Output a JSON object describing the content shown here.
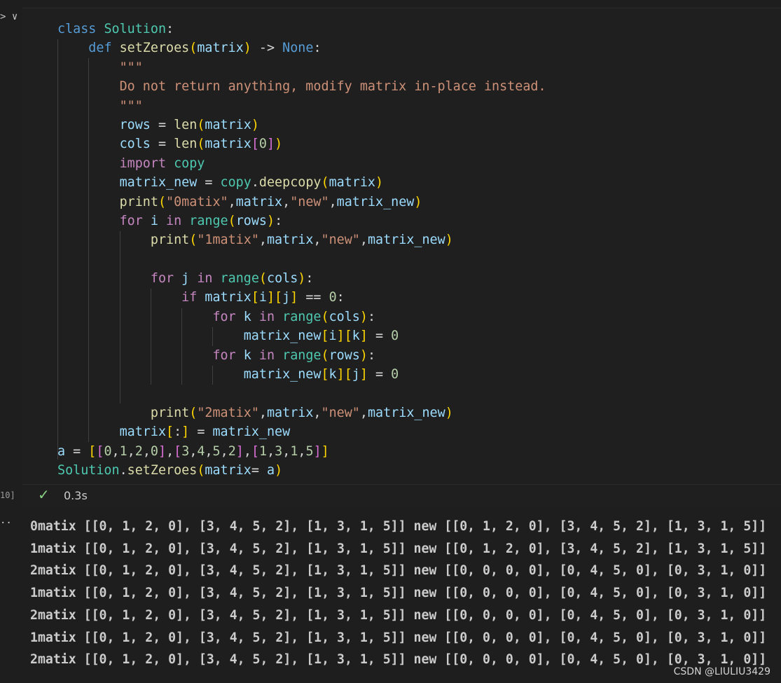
{
  "gutter": {
    "toggle": "> ∨",
    "execution_count": "10]",
    "output_marker": "··"
  },
  "code_lines": [
    [
      {
        "t": "class ",
        "c": "kw"
      },
      {
        "t": "Solution",
        "c": "cls"
      },
      {
        "t": ":",
        "c": "op"
      }
    ],
    [
      {
        "t": "    "
      },
      {
        "t": "def ",
        "c": "kw"
      },
      {
        "t": "setZeroes",
        "c": "fn"
      },
      {
        "t": "(",
        "c": "b1"
      },
      {
        "t": "matrix",
        "c": "var"
      },
      {
        "t": ")",
        "c": "b1"
      },
      {
        "t": " -> ",
        "c": "op"
      },
      {
        "t": "None",
        "c": "kw"
      },
      {
        "t": ":",
        "c": "op"
      }
    ],
    [
      {
        "t": "        "
      },
      {
        "t": "\"\"\"",
        "c": "str"
      }
    ],
    [
      {
        "t": "        "
      },
      {
        "t": "Do not return anything, modify matrix in-place instead.",
        "c": "str"
      }
    ],
    [
      {
        "t": "        "
      },
      {
        "t": "\"\"\"",
        "c": "str"
      }
    ],
    [
      {
        "t": "        "
      },
      {
        "t": "rows",
        "c": "var"
      },
      {
        "t": " = ",
        "c": "op"
      },
      {
        "t": "len",
        "c": "fn"
      },
      {
        "t": "(",
        "c": "b1"
      },
      {
        "t": "matrix",
        "c": "var"
      },
      {
        "t": ")",
        "c": "b1"
      }
    ],
    [
      {
        "t": "        "
      },
      {
        "t": "cols",
        "c": "var"
      },
      {
        "t": " = ",
        "c": "op"
      },
      {
        "t": "len",
        "c": "fn"
      },
      {
        "t": "(",
        "c": "b1"
      },
      {
        "t": "matrix",
        "c": "var"
      },
      {
        "t": "[",
        "c": "b2"
      },
      {
        "t": "0",
        "c": "num"
      },
      {
        "t": "]",
        "c": "b2"
      },
      {
        "t": ")",
        "c": "b1"
      }
    ],
    [
      {
        "t": "        "
      },
      {
        "t": "import ",
        "c": "ctl"
      },
      {
        "t": "copy",
        "c": "cls"
      }
    ],
    [
      {
        "t": "        "
      },
      {
        "t": "matrix_new",
        "c": "var"
      },
      {
        "t": " = ",
        "c": "op"
      },
      {
        "t": "copy",
        "c": "cls"
      },
      {
        "t": ".",
        "c": "op"
      },
      {
        "t": "deepcopy",
        "c": "fn"
      },
      {
        "t": "(",
        "c": "b1"
      },
      {
        "t": "matrix",
        "c": "var"
      },
      {
        "t": ")",
        "c": "b1"
      }
    ],
    [
      {
        "t": "        "
      },
      {
        "t": "print",
        "c": "fn"
      },
      {
        "t": "(",
        "c": "b1"
      },
      {
        "t": "\"0matix\"",
        "c": "str"
      },
      {
        "t": ",",
        "c": "op"
      },
      {
        "t": "matrix",
        "c": "var"
      },
      {
        "t": ",",
        "c": "op"
      },
      {
        "t": "\"new\"",
        "c": "str"
      },
      {
        "t": ",",
        "c": "op"
      },
      {
        "t": "matrix_new",
        "c": "var"
      },
      {
        "t": ")",
        "c": "b1"
      }
    ],
    [
      {
        "t": "        "
      },
      {
        "t": "for ",
        "c": "ctl"
      },
      {
        "t": "i",
        "c": "var"
      },
      {
        "t": " in ",
        "c": "ctl"
      },
      {
        "t": "range",
        "c": "cls"
      },
      {
        "t": "(",
        "c": "b1"
      },
      {
        "t": "rows",
        "c": "var"
      },
      {
        "t": ")",
        "c": "b1"
      },
      {
        "t": ":",
        "c": "op"
      }
    ],
    [
      {
        "t": "            "
      },
      {
        "t": "print",
        "c": "fn"
      },
      {
        "t": "(",
        "c": "b1"
      },
      {
        "t": "\"1matix\"",
        "c": "str"
      },
      {
        "t": ",",
        "c": "op"
      },
      {
        "t": "matrix",
        "c": "var"
      },
      {
        "t": ",",
        "c": "op"
      },
      {
        "t": "\"new\"",
        "c": "str"
      },
      {
        "t": ",",
        "c": "op"
      },
      {
        "t": "matrix_new",
        "c": "var"
      },
      {
        "t": ")",
        "c": "b1"
      }
    ],
    [
      {
        "t": ""
      }
    ],
    [
      {
        "t": "            "
      },
      {
        "t": "for ",
        "c": "ctl"
      },
      {
        "t": "j",
        "c": "var"
      },
      {
        "t": " in ",
        "c": "ctl"
      },
      {
        "t": "range",
        "c": "cls"
      },
      {
        "t": "(",
        "c": "b1"
      },
      {
        "t": "cols",
        "c": "var"
      },
      {
        "t": ")",
        "c": "b1"
      },
      {
        "t": ":",
        "c": "op"
      }
    ],
    [
      {
        "t": "                "
      },
      {
        "t": "if ",
        "c": "ctl"
      },
      {
        "t": "matrix",
        "c": "var"
      },
      {
        "t": "[",
        "c": "b1"
      },
      {
        "t": "i",
        "c": "var"
      },
      {
        "t": "]",
        "c": "b1"
      },
      {
        "t": "[",
        "c": "b1"
      },
      {
        "t": "j",
        "c": "var"
      },
      {
        "t": "]",
        "c": "b1"
      },
      {
        "t": " == ",
        "c": "op"
      },
      {
        "t": "0",
        "c": "num"
      },
      {
        "t": ":",
        "c": "op"
      }
    ],
    [
      {
        "t": "                    "
      },
      {
        "t": "for ",
        "c": "ctl"
      },
      {
        "t": "k",
        "c": "var"
      },
      {
        "t": " in ",
        "c": "ctl"
      },
      {
        "t": "range",
        "c": "cls"
      },
      {
        "t": "(",
        "c": "b1"
      },
      {
        "t": "cols",
        "c": "var"
      },
      {
        "t": ")",
        "c": "b1"
      },
      {
        "t": ":",
        "c": "op"
      }
    ],
    [
      {
        "t": "                        "
      },
      {
        "t": "matrix_new",
        "c": "var"
      },
      {
        "t": "[",
        "c": "b1"
      },
      {
        "t": "i",
        "c": "var"
      },
      {
        "t": "]",
        "c": "b1"
      },
      {
        "t": "[",
        "c": "b1"
      },
      {
        "t": "k",
        "c": "var"
      },
      {
        "t": "]",
        "c": "b1"
      },
      {
        "t": " = ",
        "c": "op"
      },
      {
        "t": "0",
        "c": "num"
      }
    ],
    [
      {
        "t": "                    "
      },
      {
        "t": "for ",
        "c": "ctl"
      },
      {
        "t": "k",
        "c": "var"
      },
      {
        "t": " in ",
        "c": "ctl"
      },
      {
        "t": "range",
        "c": "cls"
      },
      {
        "t": "(",
        "c": "b1"
      },
      {
        "t": "rows",
        "c": "var"
      },
      {
        "t": ")",
        "c": "b1"
      },
      {
        "t": ":",
        "c": "op"
      }
    ],
    [
      {
        "t": "                        "
      },
      {
        "t": "matrix_new",
        "c": "var"
      },
      {
        "t": "[",
        "c": "b1"
      },
      {
        "t": "k",
        "c": "var"
      },
      {
        "t": "]",
        "c": "b1"
      },
      {
        "t": "[",
        "c": "b1"
      },
      {
        "t": "j",
        "c": "var"
      },
      {
        "t": "]",
        "c": "b1"
      },
      {
        "t": " = ",
        "c": "op"
      },
      {
        "t": "0",
        "c": "num"
      }
    ],
    [
      {
        "t": ""
      }
    ],
    [
      {
        "t": "            "
      },
      {
        "t": "print",
        "c": "fn"
      },
      {
        "t": "(",
        "c": "b1"
      },
      {
        "t": "\"2matix\"",
        "c": "str"
      },
      {
        "t": ",",
        "c": "op"
      },
      {
        "t": "matrix",
        "c": "var"
      },
      {
        "t": ",",
        "c": "op"
      },
      {
        "t": "\"new\"",
        "c": "str"
      },
      {
        "t": ",",
        "c": "op"
      },
      {
        "t": "matrix_new",
        "c": "var"
      },
      {
        "t": ")",
        "c": "b1"
      }
    ],
    [
      {
        "t": "        "
      },
      {
        "t": "matrix",
        "c": "var"
      },
      {
        "t": "[",
        "c": "b1"
      },
      {
        "t": ":",
        "c": "op"
      },
      {
        "t": "]",
        "c": "b1"
      },
      {
        "t": " = ",
        "c": "op"
      },
      {
        "t": "matrix_new",
        "c": "var"
      }
    ],
    [
      {
        "t": "a",
        "c": "var"
      },
      {
        "t": " = ",
        "c": "op"
      },
      {
        "t": "[",
        "c": "b1"
      },
      {
        "t": "[",
        "c": "b2"
      },
      {
        "t": "0",
        "c": "num"
      },
      {
        "t": ",",
        "c": "op"
      },
      {
        "t": "1",
        "c": "num"
      },
      {
        "t": ",",
        "c": "op"
      },
      {
        "t": "2",
        "c": "num"
      },
      {
        "t": ",",
        "c": "op"
      },
      {
        "t": "0",
        "c": "num"
      },
      {
        "t": "]",
        "c": "b2"
      },
      {
        "t": ",",
        "c": "op"
      },
      {
        "t": "[",
        "c": "b2"
      },
      {
        "t": "3",
        "c": "num"
      },
      {
        "t": ",",
        "c": "op"
      },
      {
        "t": "4",
        "c": "num"
      },
      {
        "t": ",",
        "c": "op"
      },
      {
        "t": "5",
        "c": "num"
      },
      {
        "t": ",",
        "c": "op"
      },
      {
        "t": "2",
        "c": "num"
      },
      {
        "t": "]",
        "c": "b2"
      },
      {
        "t": ",",
        "c": "op"
      },
      {
        "t": "[",
        "c": "b2"
      },
      {
        "t": "1",
        "c": "num"
      },
      {
        "t": ",",
        "c": "op"
      },
      {
        "t": "3",
        "c": "num"
      },
      {
        "t": ",",
        "c": "op"
      },
      {
        "t": "1",
        "c": "num"
      },
      {
        "t": ",",
        "c": "op"
      },
      {
        "t": "5",
        "c": "num"
      },
      {
        "t": "]",
        "c": "b2"
      },
      {
        "t": "]",
        "c": "b1"
      }
    ],
    [
      {
        "t": "Solution",
        "c": "cls"
      },
      {
        "t": ".",
        "c": "op"
      },
      {
        "t": "setZeroes",
        "c": "fn"
      },
      {
        "t": "(",
        "c": "b1"
      },
      {
        "t": "matrix",
        "c": "var"
      },
      {
        "t": "= ",
        "c": "op"
      },
      {
        "t": "a",
        "c": "var"
      },
      {
        "t": ")",
        "c": "b1"
      }
    ]
  ],
  "status": {
    "check_icon": "✓",
    "duration": "0.3s"
  },
  "output_lines": [
    "0matix [[0, 1, 2, 0], [3, 4, 5, 2], [1, 3, 1, 5]] new [[0, 1, 2, 0], [3, 4, 5, 2], [1, 3, 1, 5]]",
    "1matix [[0, 1, 2, 0], [3, 4, 5, 2], [1, 3, 1, 5]] new [[0, 1, 2, 0], [3, 4, 5, 2], [1, 3, 1, 5]]",
    "2matix [[0, 1, 2, 0], [3, 4, 5, 2], [1, 3, 1, 5]] new [[0, 0, 0, 0], [0, 4, 5, 0], [0, 3, 1, 0]]",
    "1matix [[0, 1, 2, 0], [3, 4, 5, 2], [1, 3, 1, 5]] new [[0, 0, 0, 0], [0, 4, 5, 0], [0, 3, 1, 0]]",
    "2matix [[0, 1, 2, 0], [3, 4, 5, 2], [1, 3, 1, 5]] new [[0, 0, 0, 0], [0, 4, 5, 0], [0, 3, 1, 0]]",
    "1matix [[0, 1, 2, 0], [3, 4, 5, 2], [1, 3, 1, 5]] new [[0, 0, 0, 0], [0, 4, 5, 0], [0, 3, 1, 0]]",
    "2matix [[0, 1, 2, 0], [3, 4, 5, 2], [1, 3, 1, 5]] new [[0, 0, 0, 0], [0, 4, 5, 0], [0, 3, 1, 0]]"
  ],
  "watermark": "CSDN @LIULIU3429"
}
